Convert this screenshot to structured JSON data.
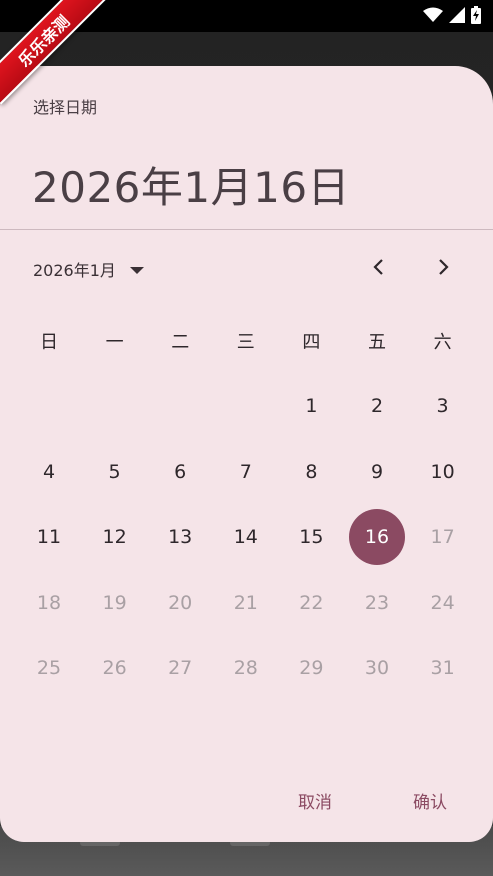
{
  "ribbon": {
    "label": "乐乐亲测"
  },
  "dialog": {
    "header_label": "选择日期",
    "selected_date_text": "2026年1月16日",
    "month_label": "2026年1月",
    "weekdays": [
      "日",
      "一",
      "二",
      "三",
      "四",
      "五",
      "六"
    ],
    "weeks": [
      [
        {
          "day": "",
          "state": "empty"
        },
        {
          "day": "",
          "state": "empty"
        },
        {
          "day": "",
          "state": "empty"
        },
        {
          "day": "",
          "state": "empty"
        },
        {
          "day": "1",
          "state": "normal"
        },
        {
          "day": "2",
          "state": "normal"
        },
        {
          "day": "3",
          "state": "normal"
        }
      ],
      [
        {
          "day": "4",
          "state": "normal"
        },
        {
          "day": "5",
          "state": "normal"
        },
        {
          "day": "6",
          "state": "normal"
        },
        {
          "day": "7",
          "state": "normal"
        },
        {
          "day": "8",
          "state": "normal"
        },
        {
          "day": "9",
          "state": "normal"
        },
        {
          "day": "10",
          "state": "normal"
        }
      ],
      [
        {
          "day": "11",
          "state": "normal"
        },
        {
          "day": "12",
          "state": "normal"
        },
        {
          "day": "13",
          "state": "normal"
        },
        {
          "day": "14",
          "state": "normal"
        },
        {
          "day": "15",
          "state": "normal"
        },
        {
          "day": "16",
          "state": "selected"
        },
        {
          "day": "17",
          "state": "disabled"
        }
      ],
      [
        {
          "day": "18",
          "state": "disabled"
        },
        {
          "day": "19",
          "state": "disabled"
        },
        {
          "day": "20",
          "state": "disabled"
        },
        {
          "day": "21",
          "state": "disabled"
        },
        {
          "day": "22",
          "state": "disabled"
        },
        {
          "day": "23",
          "state": "disabled"
        },
        {
          "day": "24",
          "state": "disabled"
        }
      ],
      [
        {
          "day": "25",
          "state": "disabled"
        },
        {
          "day": "26",
          "state": "disabled"
        },
        {
          "day": "27",
          "state": "disabled"
        },
        {
          "day": "28",
          "state": "disabled"
        },
        {
          "day": "29",
          "state": "disabled"
        },
        {
          "day": "30",
          "state": "disabled"
        },
        {
          "day": "31",
          "state": "disabled"
        }
      ]
    ],
    "cancel_label": "取消",
    "confirm_label": "确认"
  },
  "icons": {
    "wifi": "wifi-icon",
    "signal": "signal-icon",
    "battery": "battery-charging-icon",
    "dropdown": "dropdown-arrow-icon",
    "prev": "chevron-left-icon",
    "next": "chevron-right-icon"
  },
  "colors": {
    "accent": "#8b4a62",
    "dialog_bg": "#f5e4e8",
    "ribbon": "#e0141e"
  }
}
